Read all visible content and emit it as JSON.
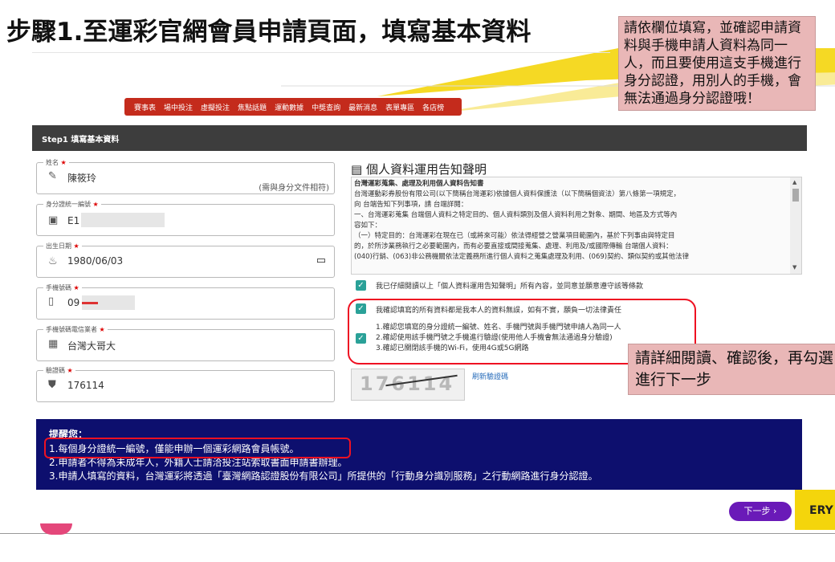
{
  "slide": {
    "title": "步驟1.至運彩官網會員申請頁面，填寫基本資料",
    "callout_top": "請依欄位填寫，並確認申請資料與手機申請人資料為同一人，而且要使用這支手機進行身分認證，用別人的手機，會無法通過身分認證哦！",
    "callout_bottom": "請詳細閱讀、確認後，再勾選進行下一步"
  },
  "nav": {
    "items": [
      "賽事表",
      "場中投注",
      "虛擬投注",
      "焦點話題",
      "運動數據",
      "中獎查詢",
      "最新消息",
      "表單專區",
      "各店榜"
    ]
  },
  "step_bar": {
    "label": "Step1 填寫基本資料"
  },
  "form": {
    "name": {
      "label": "姓名",
      "value": "陳筱玲",
      "hint": "(需與身分文件相符)"
    },
    "id_number": {
      "label": "身分證統一編號",
      "value": "E1"
    },
    "birthdate": {
      "label": "出生日期",
      "value": "1980/06/03"
    },
    "phone": {
      "label": "手機號碼",
      "value": "09"
    },
    "carrier": {
      "label": "手機號碼電信業者",
      "value": "台灣大哥大"
    },
    "captcha": {
      "label": "驗證碼",
      "value": "176114",
      "refresh_label": "刷新驗證碼",
      "image_text": "176114"
    }
  },
  "privacy": {
    "title": "個人資料運用告知聲明",
    "lines": [
      "台灣運彩蒐集、處理及利用個人資料告知書",
      "台灣運動彩券股份有限公司(以下簡稱台灣運彩)依據個人資料保護法（以下簡稱個資法）第八條第一項規定，",
      "向 台端告知下列事項，請 台端詳閱：",
      "一、台灣運彩蒐集 台端個人資料之特定目的、個人資料類別及個人資料利用之對象、期間、地區及方式等內",
      "容如下：",
      "（一）特定目的：台灣運彩在現在已（或將來可能）依法得經營之營業項目範圍內，基於下列事由與特定目",
      "的，於所涉業務執行之必要範圍內，而有必要直接或間接蒐集、處理、利用及/或國際傳輸 台端個人資料：",
      "(040)行銷、(063)非公務機關依法定義務所進行個人資料之蒐集處理及利用、(069)契約、類似契約或其他法律"
    ],
    "agree_text": "我已仔細閱讀以上「個人資料運用告知聲明」所有內容，並同意並願意遵守該等條款"
  },
  "confirm": {
    "main_text": "我確認填寫的所有資料都是我本人的資料無誤，如有不實，願負一切法律責任",
    "items": [
      "1.確認您填寫的身分證統一編號、姓名、手機門號與手機門號申請人為同一人",
      "2.確認使用該手機門號之手機進行驗證(使用他人手機會無法通過身分驗證)",
      "3.確認已關閉該手機的Wi-Fi，使用4G或5G網路"
    ]
  },
  "notice": {
    "title": "提醒您：",
    "lines": [
      "1.每個身分證統一編號，僅能申辦一個運彩網路會員帳號。",
      "2.申請者不得為未成年人，外籍人士請洽投注站索取書面申請書辦理。",
      "3.申請人填寫的資料，台灣運彩將透過「臺灣網路認證股份有限公司」所提供的「行動身分識別服務」之行動網路進行身分認證。"
    ]
  },
  "next_button": {
    "label": "下一步 ›"
  },
  "brand_fragment": "ERY",
  "colors": {
    "nav_red": "#c42b1c",
    "step_bar": "#3d3d3d",
    "notice_bg": "#0d0f6e",
    "next_button": "#6a1ab8",
    "checkbox": "#2aa198",
    "callout": "#e9b7b7",
    "highlight_red": "#e11122",
    "brand_yellow": "#f4d50c"
  }
}
